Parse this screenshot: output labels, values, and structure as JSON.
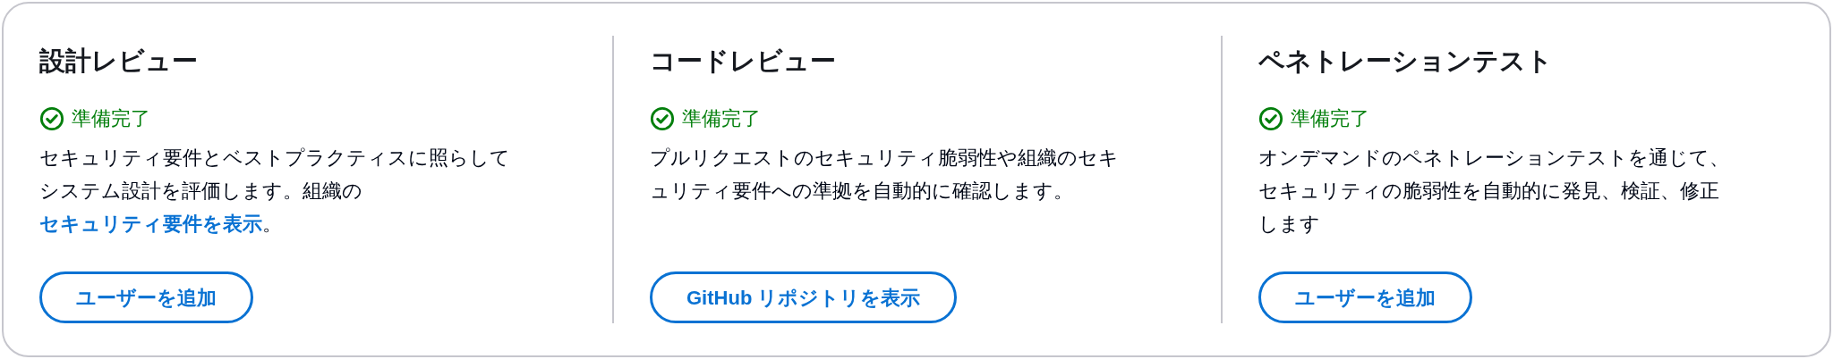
{
  "sections": [
    {
      "title": "設計レビュー",
      "status": {
        "kind": "ready",
        "label": "準備完了"
      },
      "description_lines": [
        [
          {
            "kind": "text",
            "text": "セキュリティ要件とベストプラクティスに照らして"
          }
        ],
        [
          {
            "kind": "text",
            "text": "システム設計を評価します。組織の"
          }
        ],
        [
          {
            "kind": "link",
            "text": "セキュリティ要件を表示"
          },
          {
            "kind": "text",
            "text": "。"
          }
        ]
      ],
      "button": "ユーザーを追加"
    },
    {
      "title": "コードレビュー",
      "status": {
        "kind": "ready",
        "label": "準備完了"
      },
      "description_lines": [
        [
          {
            "kind": "text",
            "text": "プルリクエストのセキュリティ脆弱性や組織のセキ"
          }
        ],
        [
          {
            "kind": "text",
            "text": "ュリティ要件への準拠を自動的に確認します。"
          }
        ]
      ],
      "button": "GitHub リポジトリを表示"
    },
    {
      "title": "ペネトレーションテスト",
      "status": {
        "kind": "ready",
        "label": "準備完了"
      },
      "description_lines": [
        [
          {
            "kind": "text",
            "text": "オンデマンドのペネトレーションテストを通じて、"
          }
        ],
        [
          {
            "kind": "text",
            "text": "セキュリティの脆弱性を自動的に発見、検証、修正"
          }
        ],
        [
          {
            "kind": "text",
            "text": "します"
          }
        ]
      ],
      "button": "ユーザーを追加"
    }
  ]
}
